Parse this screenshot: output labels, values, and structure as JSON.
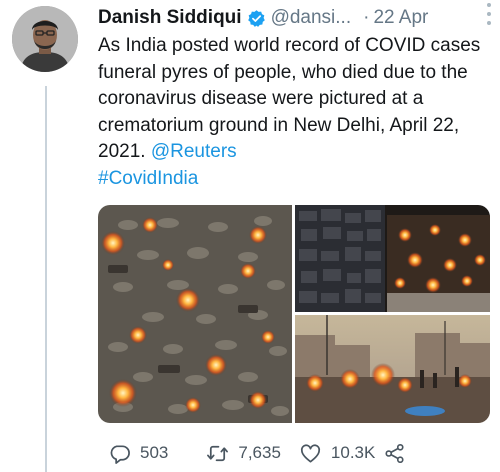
{
  "tweet": {
    "author_name": "Danish Siddiqui",
    "handle": "@dansi...",
    "separator": "·",
    "date": "22 Apr",
    "text_main": "As India posted world record of COVID cases funeral pyres of people, who died due to the coronavirus disease were pictured at a crematorium ground in New Delhi, April 22, 2021. ",
    "mention": "@Reuters",
    "hashtag": "#CovidIndia"
  },
  "actions": {
    "replies": "503",
    "retweets": "7,635",
    "likes": "10.3K"
  },
  "colors": {
    "link": "#1b95e0",
    "verified": "#1da1f2",
    "secondary_text": "#657786",
    "icon": "#4a5660"
  },
  "icons": [
    "verified-badge-icon",
    "more-options-icon",
    "reply-icon",
    "retweet-icon",
    "like-icon",
    "share-icon"
  ]
}
